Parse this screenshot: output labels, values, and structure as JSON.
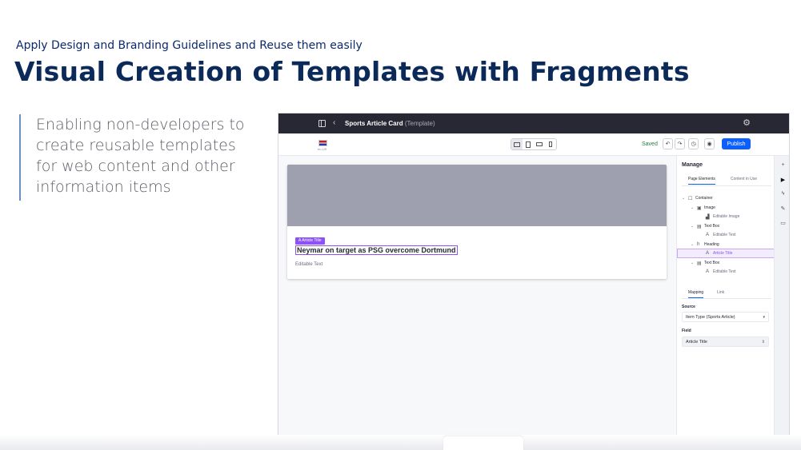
{
  "slide": {
    "subtitle": "Apply Design and Branding Guidelines and Reuse them easily",
    "title": "Visual Creation of Templates with Fragments",
    "quote_lines": [
      "Enabling non-developers to",
      "create reusable templates",
      "for web content and other",
      "information items"
    ]
  },
  "app": {
    "topbar": {
      "template_name": "Sports Article Card",
      "template_type": "(Template)",
      "icons": [
        "sidebar-toggle-icon",
        "chevron-left-icon",
        "gear-icon"
      ]
    },
    "toolbar": {
      "locale_label": "en-US",
      "saved_label": "Saved",
      "publish_label": "Publish",
      "undo_icon": "↶",
      "redo_icon": "↷",
      "history_icon": "◷",
      "preview_icon": "◉"
    },
    "canvas": {
      "tag_label": "Article Title",
      "heading_text": "Neymar on target as PSG overcome Dortmund",
      "editable_text": "Editable Text"
    },
    "panel": {
      "title": "Manage",
      "tabs": [
        "Page Elements",
        "Content in Use"
      ],
      "tree": [
        {
          "label": "Container",
          "icon": "☐",
          "chev": "⌄"
        },
        {
          "label": "Image",
          "icon": "▣",
          "chev": "⌄"
        },
        {
          "label": "Editable Image",
          "icon": "▟",
          "chev": ""
        },
        {
          "label": "Text Box",
          "icon": "▤",
          "chev": "⌄"
        },
        {
          "label": "Editable Text",
          "icon": "A",
          "chev": ""
        },
        {
          "label": "Heading",
          "icon": "h",
          "chev": "⌄"
        },
        {
          "label": "Article Title",
          "icon": "A",
          "chev": ""
        },
        {
          "label": "Text Box",
          "icon": "▤",
          "chev": "⌄"
        },
        {
          "label": "Editable Text",
          "icon": "A",
          "chev": ""
        }
      ],
      "mapping_tabs": [
        "Mapping",
        "Link"
      ],
      "source_label": "Source",
      "source_value": "Item Type (Sports Article)",
      "field_label": "Field",
      "field_value": "Article Title"
    },
    "rail_icons": [
      "+",
      "▶",
      "ϟ",
      "✎",
      "▭"
    ]
  }
}
